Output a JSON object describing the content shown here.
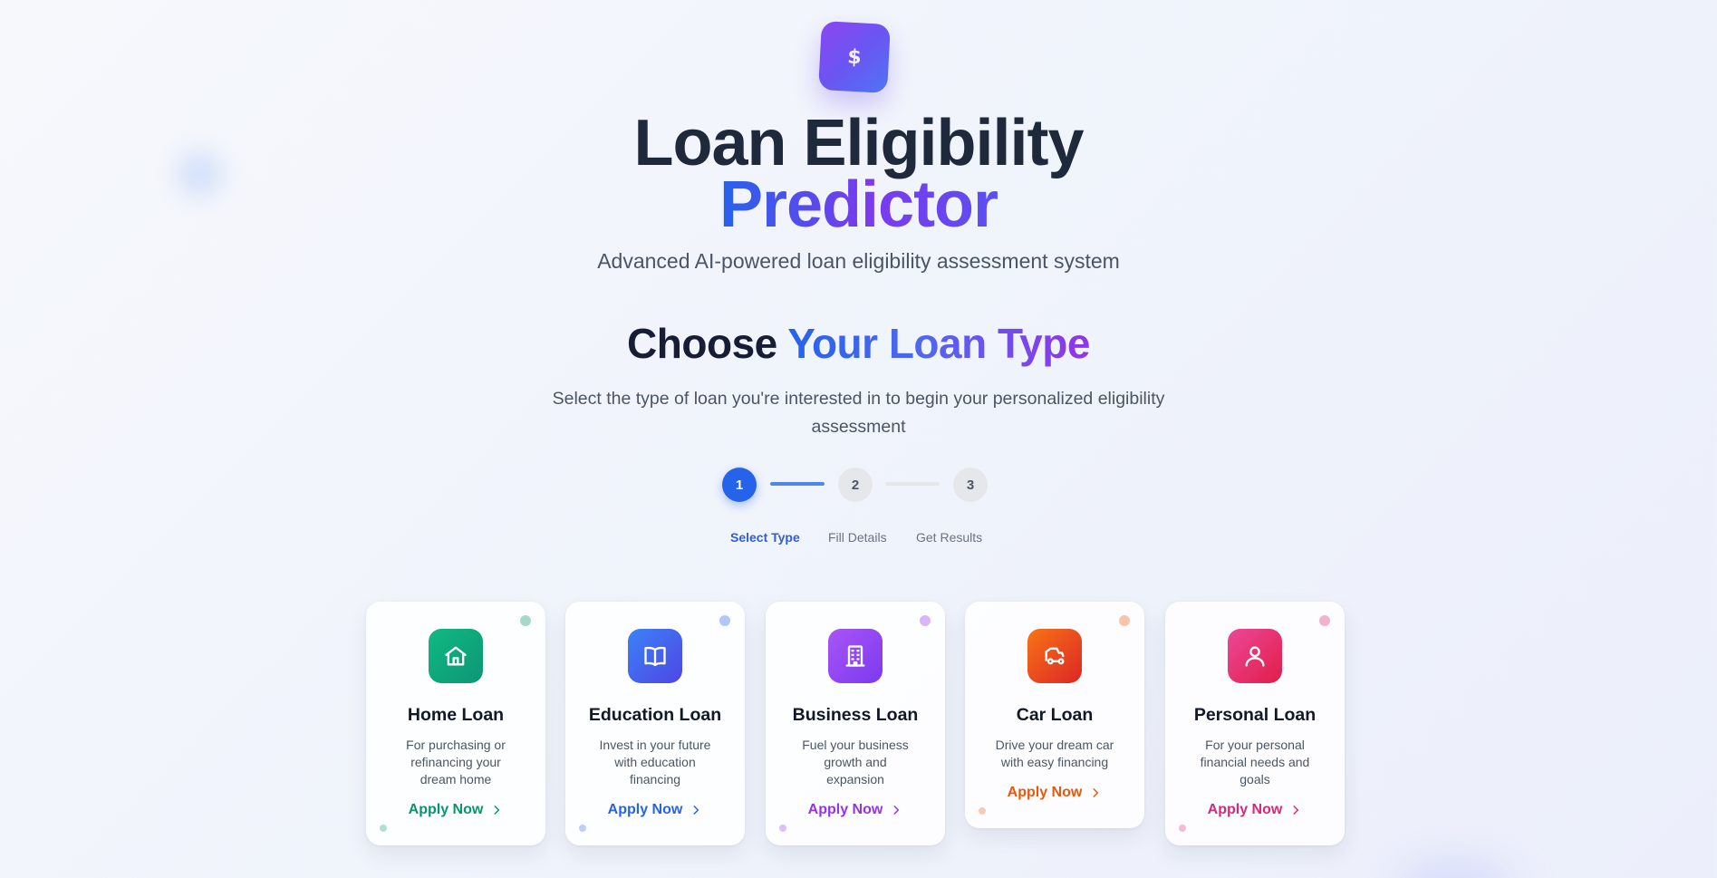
{
  "header": {
    "logo_icon": "dollar-icon",
    "logo_symbol": "$",
    "title_line1": "Loan Eligibility",
    "title_line2": "Predictor",
    "subtitle": "Advanced AI-powered loan eligibility assessment system"
  },
  "section": {
    "title_part1": "Choose",
    "title_part2": "Your Loan Type",
    "description": "Select the type of loan you're interested in to begin your personalized eligibility assessment"
  },
  "steps": [
    {
      "number": "1",
      "label": "Select Type",
      "active": true
    },
    {
      "number": "2",
      "label": "Fill Details",
      "active": false
    },
    {
      "number": "3",
      "label": "Get Results",
      "active": false
    }
  ],
  "loan_types": [
    {
      "title": "Home Loan",
      "description": "For purchasing or refinancing your dream home",
      "cta": "Apply Now",
      "icon": "home-icon",
      "accent": "#059669",
      "gradient": [
        "#10b981",
        "#0d9676"
      ]
    },
    {
      "title": "Education Loan",
      "description": "Invest in your future with education financing",
      "cta": "Apply Now",
      "icon": "book-icon",
      "accent": "#2563eb",
      "gradient": [
        "#3b82f6",
        "#4f46e5"
      ]
    },
    {
      "title": "Business Loan",
      "description": "Fuel your business growth and expansion",
      "cta": "Apply Now",
      "icon": "building-icon",
      "accent": "#9333ea",
      "gradient": [
        "#a855f7",
        "#7c3aed"
      ]
    },
    {
      "title": "Car Loan",
      "description": "Drive your dream car with easy financing",
      "cta": "Apply Now",
      "icon": "car-icon",
      "accent": "#ea580c",
      "gradient": [
        "#f97316",
        "#dc2626"
      ]
    },
    {
      "title": "Personal Loan",
      "description": "For your personal financial needs and goals",
      "cta": "Apply Now",
      "icon": "user-icon",
      "accent": "#db2777",
      "gradient": [
        "#ec4899",
        "#e11d48"
      ]
    }
  ]
}
